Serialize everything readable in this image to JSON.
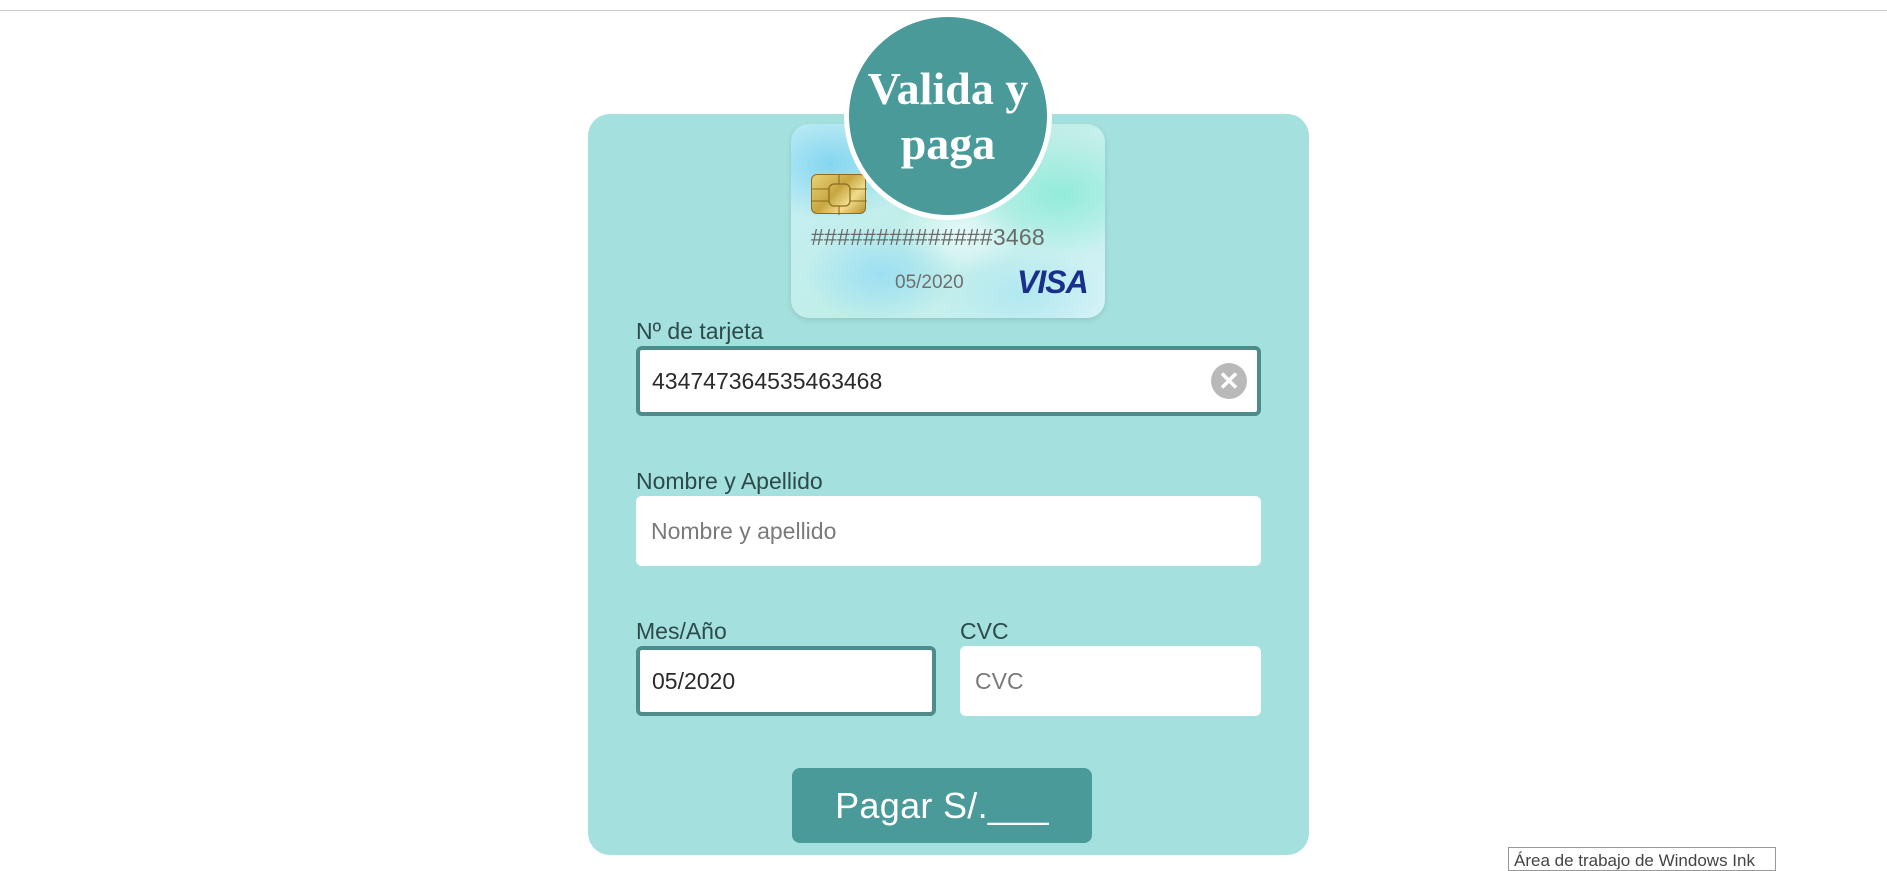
{
  "badge": {
    "title": "Valida y paga"
  },
  "card_preview": {
    "masked_number": "##############3468",
    "expiry": "05/2020",
    "brand": "VISA",
    "chip_icon": "sim-chip-icon"
  },
  "form": {
    "card_number": {
      "label": "Nº de tarjeta",
      "value": "434747364535463468",
      "clear_icon": "close-circle-icon",
      "clear_symbol": "✕"
    },
    "name": {
      "label": "Nombre y Apellido",
      "placeholder": "Nombre y apellido"
    },
    "expiry": {
      "label": "Mes/Año",
      "value": "05/2020"
    },
    "cvc": {
      "label": "CVC",
      "placeholder": "CVC"
    },
    "pay_button": "Pagar S/.___"
  },
  "tooltip": {
    "text": "Área de trabajo de Windows Ink"
  },
  "colors": {
    "panel": "#a4e1de",
    "accent": "#4a9a99",
    "focus_border": "#4d8c8a"
  }
}
